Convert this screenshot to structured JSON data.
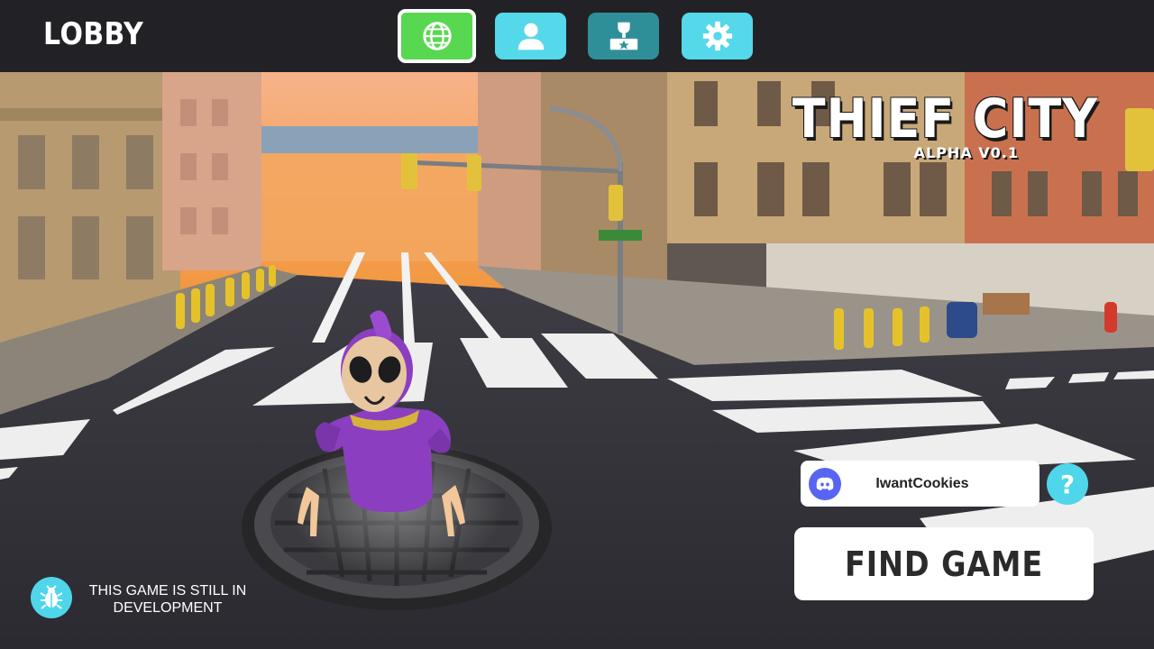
{
  "header": {
    "title": "LOBBY",
    "nav": [
      {
        "name": "globe-icon",
        "color": "#58d850",
        "active": true
      },
      {
        "name": "profile-icon",
        "color": "#55d8ea",
        "active": false
      },
      {
        "name": "trophy-icon",
        "color": "#2f8f98",
        "active": false
      },
      {
        "name": "gear-icon",
        "color": "#55d8ea",
        "active": false
      }
    ]
  },
  "game": {
    "title": "THIEF CITY",
    "version": "ALPHA V0.1"
  },
  "account": {
    "username": "IwantCookies",
    "service_icon": "discord-icon",
    "help_label": "?"
  },
  "actions": {
    "find_game_label": "FIND GAME"
  },
  "notice": {
    "icon": "bug-icon",
    "text_line1": "THIS GAME IS STILL IN",
    "text_line2": "DEVELOPMENT"
  },
  "colors": {
    "accent": "#4fd6ea",
    "topbar": "#222226",
    "discord": "#5865f2",
    "character": "#8b3fc0"
  }
}
